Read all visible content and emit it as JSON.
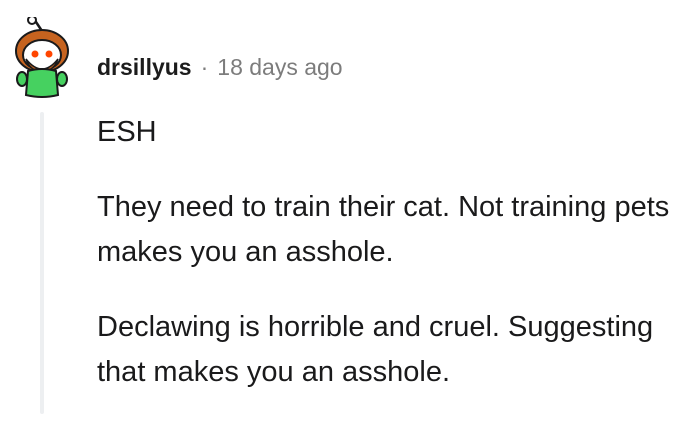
{
  "comment": {
    "username": "drsillyus",
    "separator": "·",
    "timestamp": "18 days ago",
    "avatar_icon": "reddit-snoo-avatar-icon",
    "paragraphs": [
      "ESH",
      "They need to train their cat. Not training pets makes you an asshole.",
      "Declawing is horrible and cruel. Suggesting that makes you an asshole."
    ]
  },
  "colors": {
    "username": "#1c1c1c",
    "meta": "#7c7c7c",
    "body": "#1a1a1b",
    "thread_line": "#edeff1",
    "avatar_shirt": "#46d160",
    "avatar_hair": "#c6631f"
  }
}
